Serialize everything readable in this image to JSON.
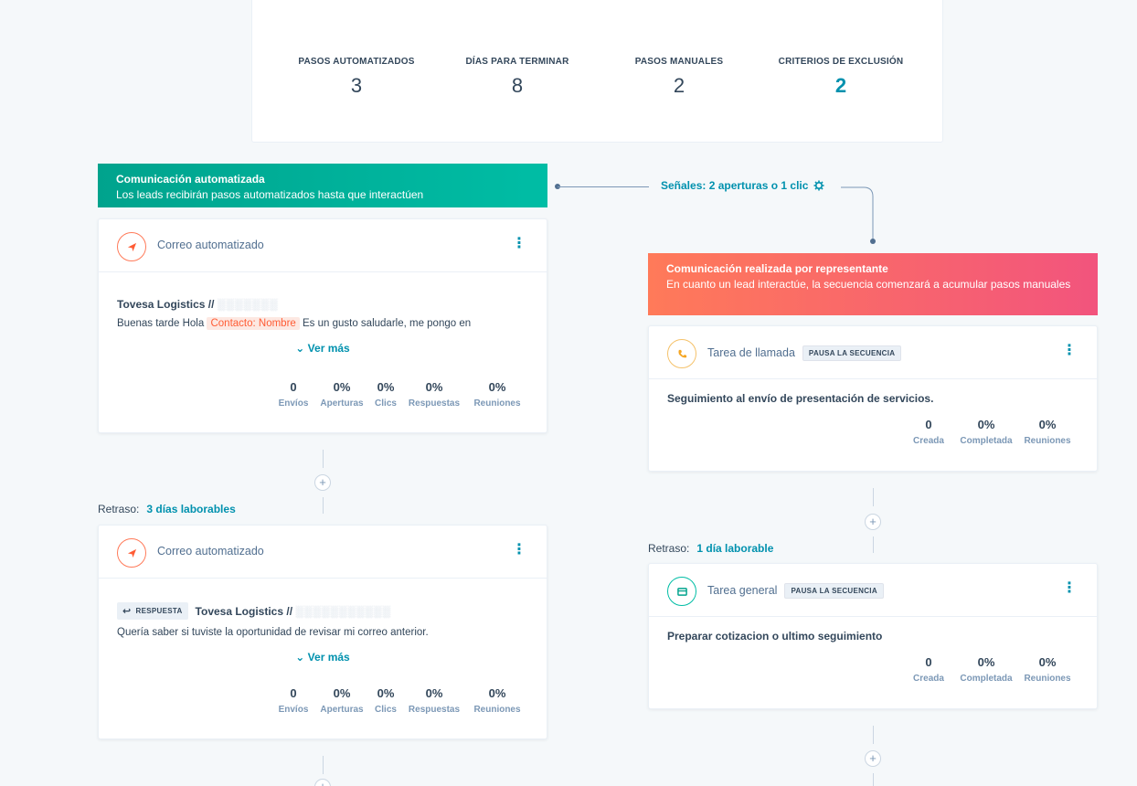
{
  "summary": {
    "stats": [
      {
        "label": "PASOS AUTOMATIZADOS",
        "value": "3"
      },
      {
        "label": "DÍAS PARA TERMINAR",
        "value": "8"
      },
      {
        "label": "PASOS MANUALES",
        "value": "2"
      },
      {
        "label": "CRITERIOS DE EXCLUSIÓN",
        "value": "2"
      }
    ]
  },
  "auto_banner": {
    "title": "Comunicación automatizada",
    "text": "Los leads recibirán pasos automatizados hasta que interactúen"
  },
  "signals": {
    "label": "Señales: 2 aperturas o 1 clic",
    "icon": "gear-icon"
  },
  "rep_banner": {
    "title": "Comunicación realizada por representante",
    "text": "En cuanto un lead interactúe, la secuencia comenzará a acumular pasos manuales"
  },
  "email_metric_labels": [
    "Envíos",
    "Aperturas",
    "Clics",
    "Respuestas",
    "Reuniones"
  ],
  "task_metric_labels": [
    "Creada",
    "Completada",
    "Reuniones"
  ],
  "steps_left": [
    {
      "type": "Correo automatizado",
      "subject": "Tovesa Logistics //",
      "subject_redacted": "░░░░░░░",
      "snippet_before": "Buenas tarde Hola",
      "token": "Contacto: Nombre",
      "snippet_after": "Es un gusto saludarle, me pongo en",
      "see_more": "Ver más",
      "metrics": [
        "0",
        "0%",
        "0%",
        "0%",
        "0%"
      ]
    },
    {
      "delay_label": "Retraso:",
      "delay_value": "3 días laborables",
      "type": "Correo automatizado",
      "reply_badge": "RESPUESTA",
      "subject": "Tovesa Logistics //",
      "subject_redacted": "░░░░░░░░░░░",
      "snippet": "Quería saber si tuviste la oportunidad de revisar mi correo anterior.",
      "see_more": "Ver más",
      "metrics": [
        "0",
        "0%",
        "0%",
        "0%",
        "0%"
      ]
    }
  ],
  "steps_right": [
    {
      "type": "Tarea de llamada",
      "badge": "PAUSA LA SECUENCIA",
      "title": "Seguimiento al envío de presentación de servicios.",
      "metrics": [
        "0",
        "0%",
        "0%"
      ]
    },
    {
      "delay_label": "Retraso:",
      "delay_value": "1 día laborable",
      "type": "Tarea general",
      "badge": "PAUSA LA SECUENCIA",
      "title": "Preparar cotizacion o ultimo seguimiento",
      "metrics": [
        "0",
        "0%",
        "0%"
      ]
    }
  ],
  "colors": {
    "accent": "#0091ae",
    "green": "#00bda5",
    "orange": "#ff7a59",
    "pink": "#f2547d"
  }
}
